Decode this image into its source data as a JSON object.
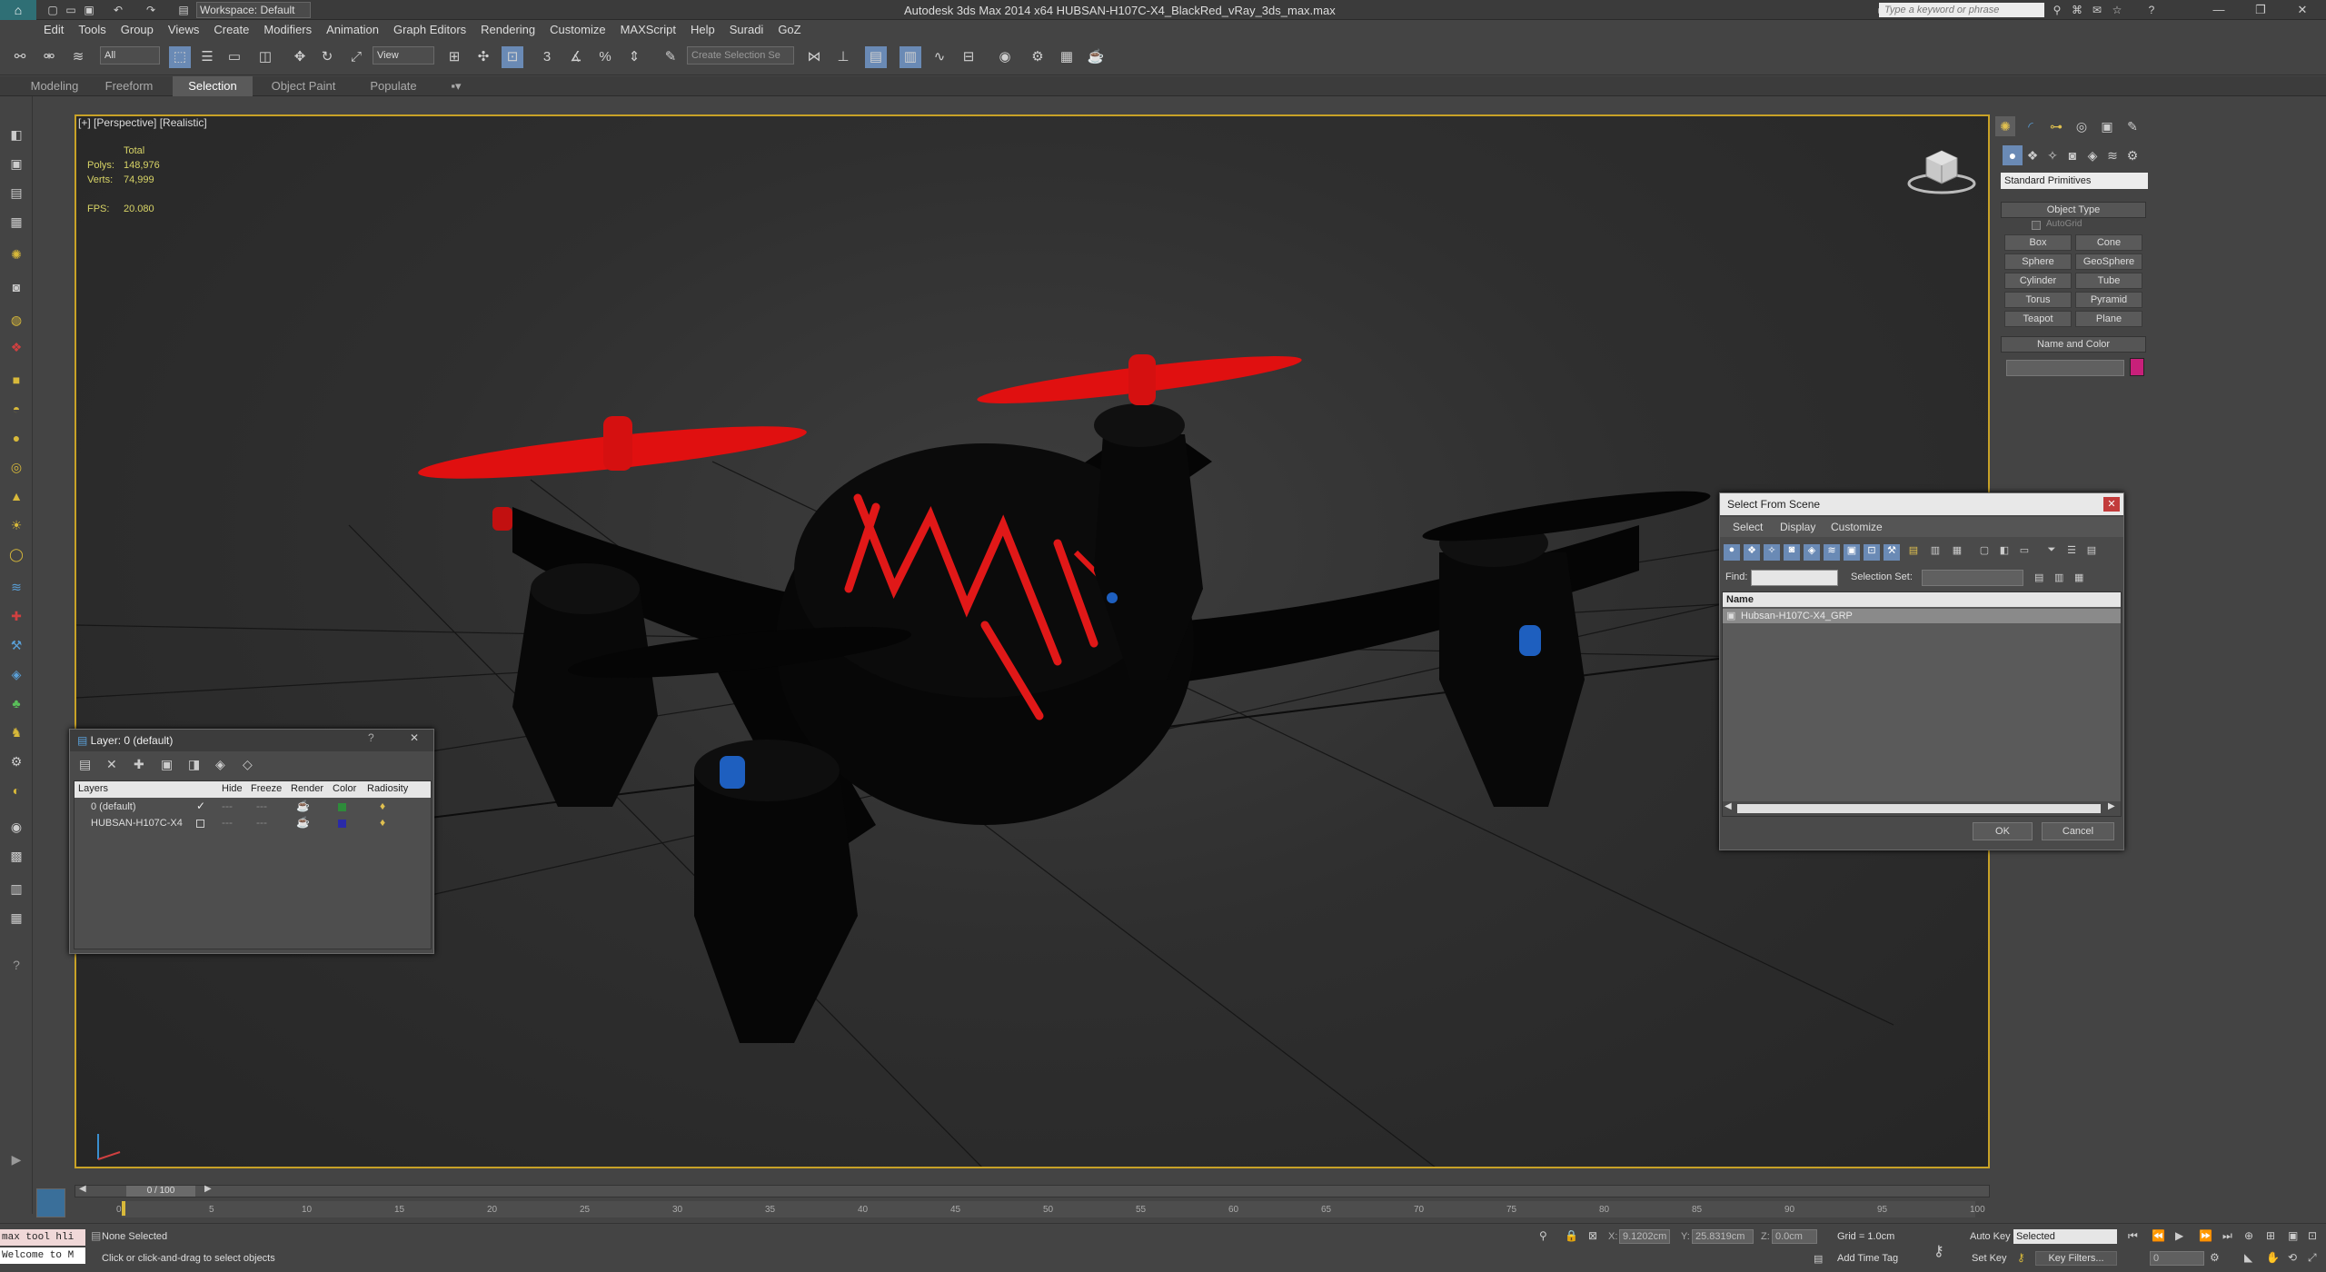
{
  "titlebar": {
    "workspace": "Workspace: Default",
    "title": "Autodesk 3ds Max  2014 x64     HUBSAN-H107C-X4_BlackRed_vRay_3ds_max.max",
    "search_placeholder": "Type a keyword or phrase"
  },
  "menu": [
    "Edit",
    "Tools",
    "Group",
    "Views",
    "Create",
    "Modifiers",
    "Animation",
    "Graph Editors",
    "Rendering",
    "Customize",
    "MAXScript",
    "Help",
    "Suradi",
    "GoZ"
  ],
  "toolbar": {
    "filter_value": "All",
    "ref_coord_value": "View",
    "selection_set_placeholder": "Create Selection Se"
  },
  "ribbon_tabs": [
    "Modeling",
    "Freeform",
    "Selection",
    "Object Paint",
    "Populate"
  ],
  "viewport": {
    "label": "[+] [Perspective] [Realistic]",
    "stats": {
      "total_label": "Total",
      "polys_label": "Polys:",
      "polys": "148,976",
      "verts_label": "Verts:",
      "verts": "74,999",
      "fps_label": "FPS:",
      "fps": "20.080"
    }
  },
  "command_panel": {
    "category": "Standard Primitives",
    "object_type_title": "Object Type",
    "autogrid_label": "AutoGrid",
    "buttons": [
      "Box",
      "Cone",
      "Sphere",
      "GeoSphere",
      "Cylinder",
      "Tube",
      "Torus",
      "Pyramid",
      "Teapot",
      "Plane"
    ],
    "name_color_title": "Name and Color",
    "object_color": "#c8207a"
  },
  "layer_dialog": {
    "title": "Layer: 0 (default)",
    "columns": [
      "Layers",
      "Hide",
      "Freeze",
      "Render",
      "Color",
      "Radiosity"
    ],
    "rows": [
      {
        "name": "0 (default)",
        "color": "#2e8b3a"
      },
      {
        "name": "HUBSAN-H107C-X4",
        "color": "#2a2aa8"
      }
    ]
  },
  "select_dialog": {
    "title": "Select From Scene",
    "menus": [
      "Select",
      "Display",
      "Customize"
    ],
    "find_label": "Find:",
    "selection_set_label": "Selection Set:",
    "column_name": "Name",
    "items": [
      "Hubsan-H107C-X4_GRP"
    ],
    "ok_label": "OK",
    "cancel_label": "Cancel"
  },
  "timeline": {
    "frame_label": "0 / 100",
    "ticks": [
      "0",
      "5",
      "10",
      "15",
      "20",
      "25",
      "30",
      "35",
      "40",
      "45",
      "50",
      "55",
      "60",
      "65",
      "70",
      "75",
      "80",
      "85",
      "90",
      "95",
      "100"
    ]
  },
  "status": {
    "maxscript_line1": "max tool hli",
    "maxscript_line2": "Welcome to M",
    "selection": "None Selected",
    "prompt": "Click or click-and-drag to select objects",
    "x_label": "X:",
    "x_value": "9.1202cm",
    "y_label": "Y:",
    "y_value": "25.8319cm",
    "z_label": "Z:",
    "z_value": "0.0cm",
    "grid": "Grid = 1.0cm",
    "add_time_tag": "Add Time Tag",
    "auto_key": "Auto Key",
    "auto_key_value": "Selected",
    "set_key": "Set Key",
    "key_filters": "Key Filters...",
    "frame_value": "0"
  }
}
